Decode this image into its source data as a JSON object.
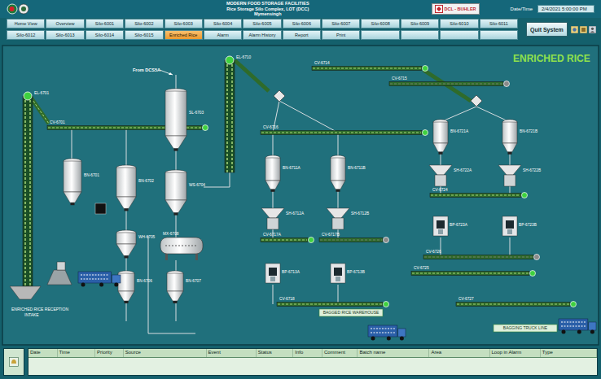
{
  "header": {
    "title_lines": [
      "MODERN FOOD STORAGE FACILITIES",
      "Rice Storage Silo Complex, LOT (DCC)",
      "Mymensingh"
    ],
    "brand": "DCL - BUHLER",
    "datetime_label": "Date/Time",
    "datetime": "2/4/2021 5:00:00 PM"
  },
  "nav": [
    {
      "label": "Home View",
      "selected": false
    },
    {
      "label": "Overview",
      "selected": false
    },
    {
      "label": "Silo-6001",
      "selected": false
    },
    {
      "label": "Silo-6002",
      "selected": false
    },
    {
      "label": "Silo-6003",
      "selected": false
    },
    {
      "label": "Silo-6004",
      "selected": false
    },
    {
      "label": "Silo-6005",
      "selected": false
    },
    {
      "label": "Silo-6006",
      "selected": false
    },
    {
      "label": "Silo-6007",
      "selected": false
    },
    {
      "label": "Silo-6008",
      "selected": false
    },
    {
      "label": "Silo-6009",
      "selected": false
    },
    {
      "label": "Silo-6010",
      "selected": false
    },
    {
      "label": "Silo-6011",
      "selected": false
    },
    {
      "label": "Silo-6012",
      "selected": false
    },
    {
      "label": "Silo-6013",
      "selected": false
    },
    {
      "label": "Silo-6014",
      "selected": false
    },
    {
      "label": "Silo-6015",
      "selected": false
    },
    {
      "label": "Enriched Rice",
      "selected": true
    },
    {
      "label": "Alarm",
      "selected": false
    },
    {
      "label": "Alarm History",
      "selected": false
    },
    {
      "label": "Report",
      "selected": false
    },
    {
      "label": "Print",
      "selected": false
    },
    {
      "label": "",
      "selected": false
    },
    {
      "label": "",
      "selected": false
    },
    {
      "label": "",
      "selected": false
    },
    {
      "label": "",
      "selected": false
    }
  ],
  "quit_button": "Quit System",
  "screen_title": "ENRICHED RICE",
  "diagram": {
    "source_label": "From DCS5A",
    "bins": [
      {
        "tag": "BN-6701"
      },
      {
        "tag": "BN-6702"
      },
      {
        "tag": "SL-6703"
      },
      {
        "tag": "WS-6704"
      },
      {
        "tag": "WH-6705"
      },
      {
        "tag": "BN-6706"
      },
      {
        "tag": "BN-6707"
      },
      {
        "tag": "BN-6711A"
      },
      {
        "tag": "BN-6711B"
      },
      {
        "tag": "BN-6721A"
      },
      {
        "tag": "BN-6721B"
      }
    ],
    "hoppers": [
      {
        "tag": "SH-6712A"
      },
      {
        "tag": "SH-6712B"
      },
      {
        "tag": "SH-6722A"
      },
      {
        "tag": "SH-6722B"
      }
    ],
    "packers": [
      {
        "tag": "BP-6713A"
      },
      {
        "tag": "BP-6713B"
      },
      {
        "tag": "BP-6723A"
      },
      {
        "tag": "BP-6723B"
      }
    ],
    "mixer": {
      "tag": "MX-6708"
    },
    "elevators": [
      {
        "tag": "EL-6701",
        "running": true
      },
      {
        "tag": "EL-6710",
        "running": true
      }
    ],
    "conveyors": [
      {
        "tag": "CV-6701",
        "running": true
      },
      {
        "tag": "CV-6714",
        "running": true
      },
      {
        "tag": "CV-6715",
        "running": false
      },
      {
        "tag": "CV-6716",
        "running": true
      },
      {
        "tag": "CV-6717A",
        "running": true
      },
      {
        "tag": "CV-6717B",
        "running": false
      },
      {
        "tag": "CV-6724",
        "running": true
      },
      {
        "tag": "CV-6725",
        "running": true
      },
      {
        "tag": "CV-6726",
        "running": false
      },
      {
        "tag": "CV-6718",
        "running": true
      },
      {
        "tag": "CV-6727",
        "running": true
      }
    ],
    "areas": [
      {
        "label": "ENRICHED RICE RECEPTION",
        "kind": "caption"
      },
      {
        "label": "INTAKE",
        "kind": "caption"
      },
      {
        "label": "BAGGED RICE WAREHOUSE",
        "kind": "box"
      },
      {
        "label": "BAGGING TRUCK LINE",
        "kind": "box"
      }
    ]
  },
  "alarm_table": {
    "columns": [
      "Date",
      "Time",
      "Priority",
      "Source",
      "Event",
      "Status",
      "Info",
      "Comment",
      "Batch name",
      "Area",
      "Loop in Alarm",
      "Type"
    ],
    "rows": []
  }
}
